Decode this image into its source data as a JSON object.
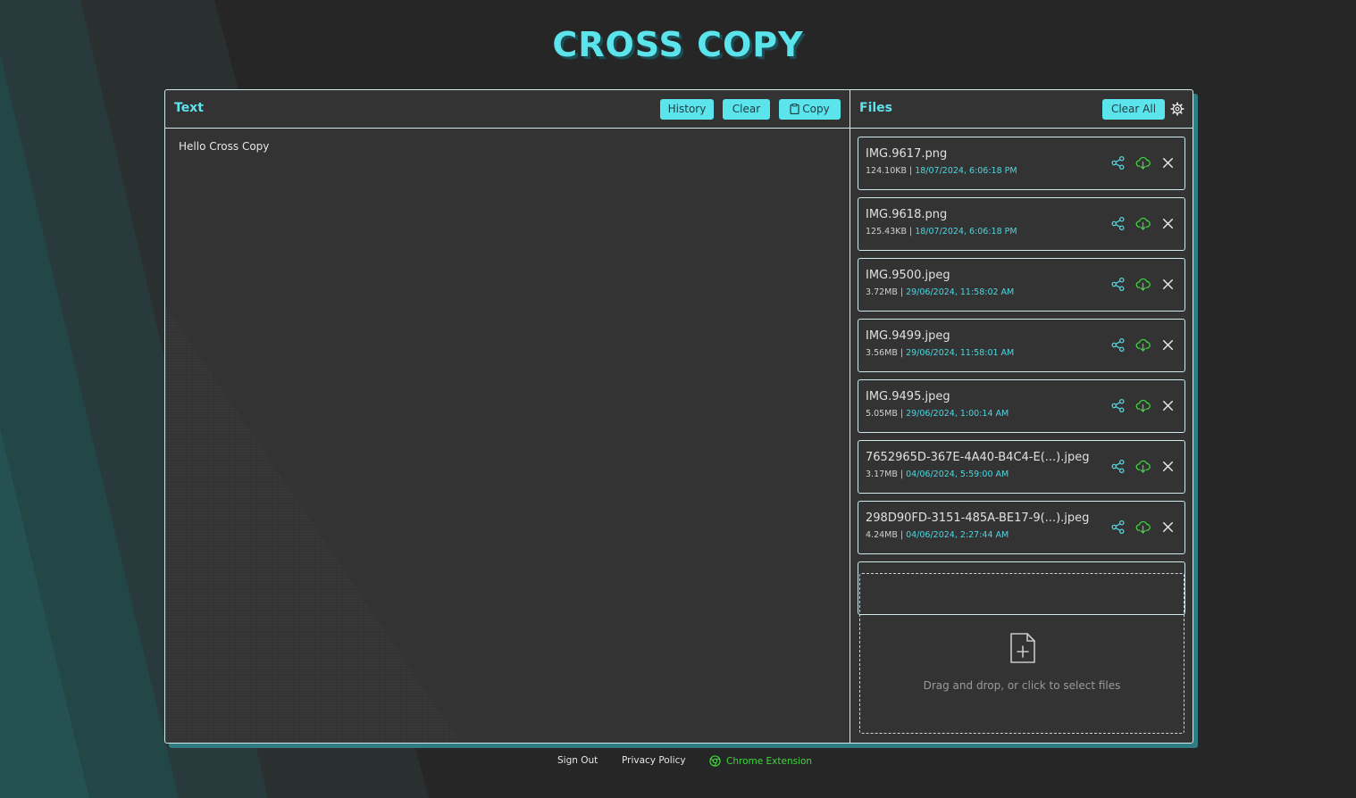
{
  "app": {
    "title": "CROSS COPY"
  },
  "text_panel": {
    "title": "Text",
    "history_label": "History",
    "clear_label": "Clear",
    "copy_label": "Copy",
    "content": "Hello Cross Copy"
  },
  "files_panel": {
    "title": "Files",
    "clear_all_label": "Clear All",
    "files": [
      {
        "name": "IMG.9617.png",
        "size": "124.10KB",
        "date": "18/07/2024, 6:06:18 PM"
      },
      {
        "name": "IMG.9618.png",
        "size": "125.43KB",
        "date": "18/07/2024, 6:06:18 PM"
      },
      {
        "name": "IMG.9500.jpeg",
        "size": "3.72MB",
        "date": "29/06/2024, 11:58:02 AM"
      },
      {
        "name": "IMG.9499.jpeg",
        "size": "3.56MB",
        "date": "29/06/2024, 11:58:01 AM"
      },
      {
        "name": "IMG.9495.jpeg",
        "size": "5.05MB",
        "date": "29/06/2024, 1:00:14 AM"
      },
      {
        "name": "7652965D-367E-4A40-B4C4-E(...).jpeg",
        "size": "3.17MB",
        "date": "04/06/2024, 5:59:00 AM"
      },
      {
        "name": "298D90FD-3151-485A-BE17-9(...).jpeg",
        "size": "4.24MB",
        "date": "04/06/2024, 2:27:44 AM"
      }
    ],
    "dropzone_text": "Drag and drop, or click to select files"
  },
  "footer": {
    "sign_out": "Sign Out",
    "privacy_policy": "Privacy Policy",
    "chrome_extension": "Chrome Extension"
  },
  "colors": {
    "accent": "#5ce4ec",
    "background": "#262626",
    "panel": "#333333",
    "download": "#3ed63e"
  }
}
